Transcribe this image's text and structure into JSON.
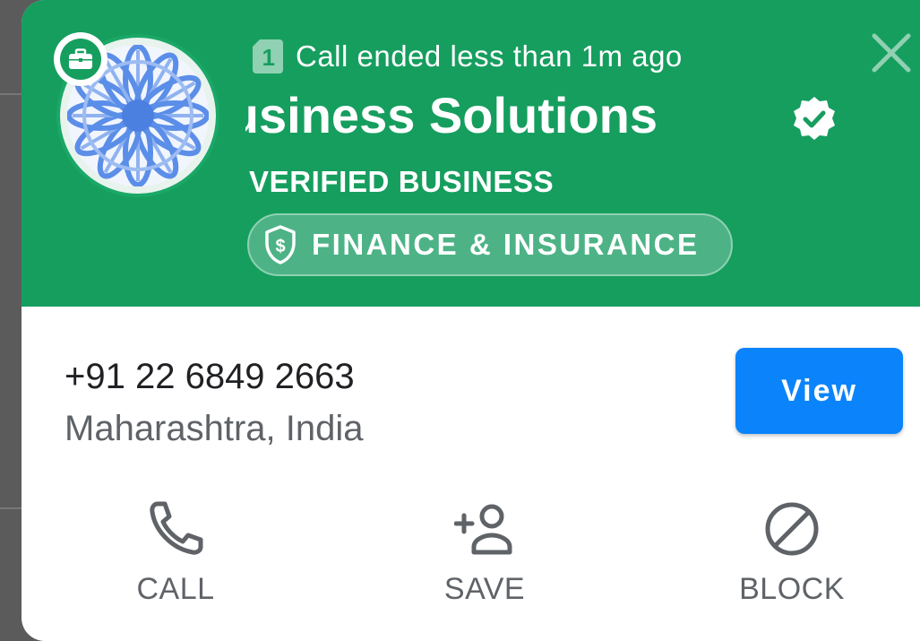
{
  "header": {
    "call_status": "Call ended less than 1m ago",
    "sim_slot": "1",
    "business_name": "Business Solutions",
    "verified_label": "VERIFIED BUSINESS",
    "category": "FINANCE & INSURANCE"
  },
  "contact": {
    "phone": "+91 22 6849 2663",
    "location": "Maharashtra, India",
    "view_label": "View"
  },
  "actions": {
    "call_label": "CALL",
    "save_label": "SAVE",
    "block_label": "BLOCK"
  },
  "colors": {
    "header_green": "#169e5f",
    "view_blue": "#0b84fb",
    "icon_gray": "#5f6368"
  },
  "icons": {
    "close": "close-icon",
    "verified": "verified-icon",
    "category": "shield-dollar-icon",
    "business": "briefcase-icon",
    "call": "phone-icon",
    "save": "add-person-icon",
    "block": "block-icon"
  }
}
